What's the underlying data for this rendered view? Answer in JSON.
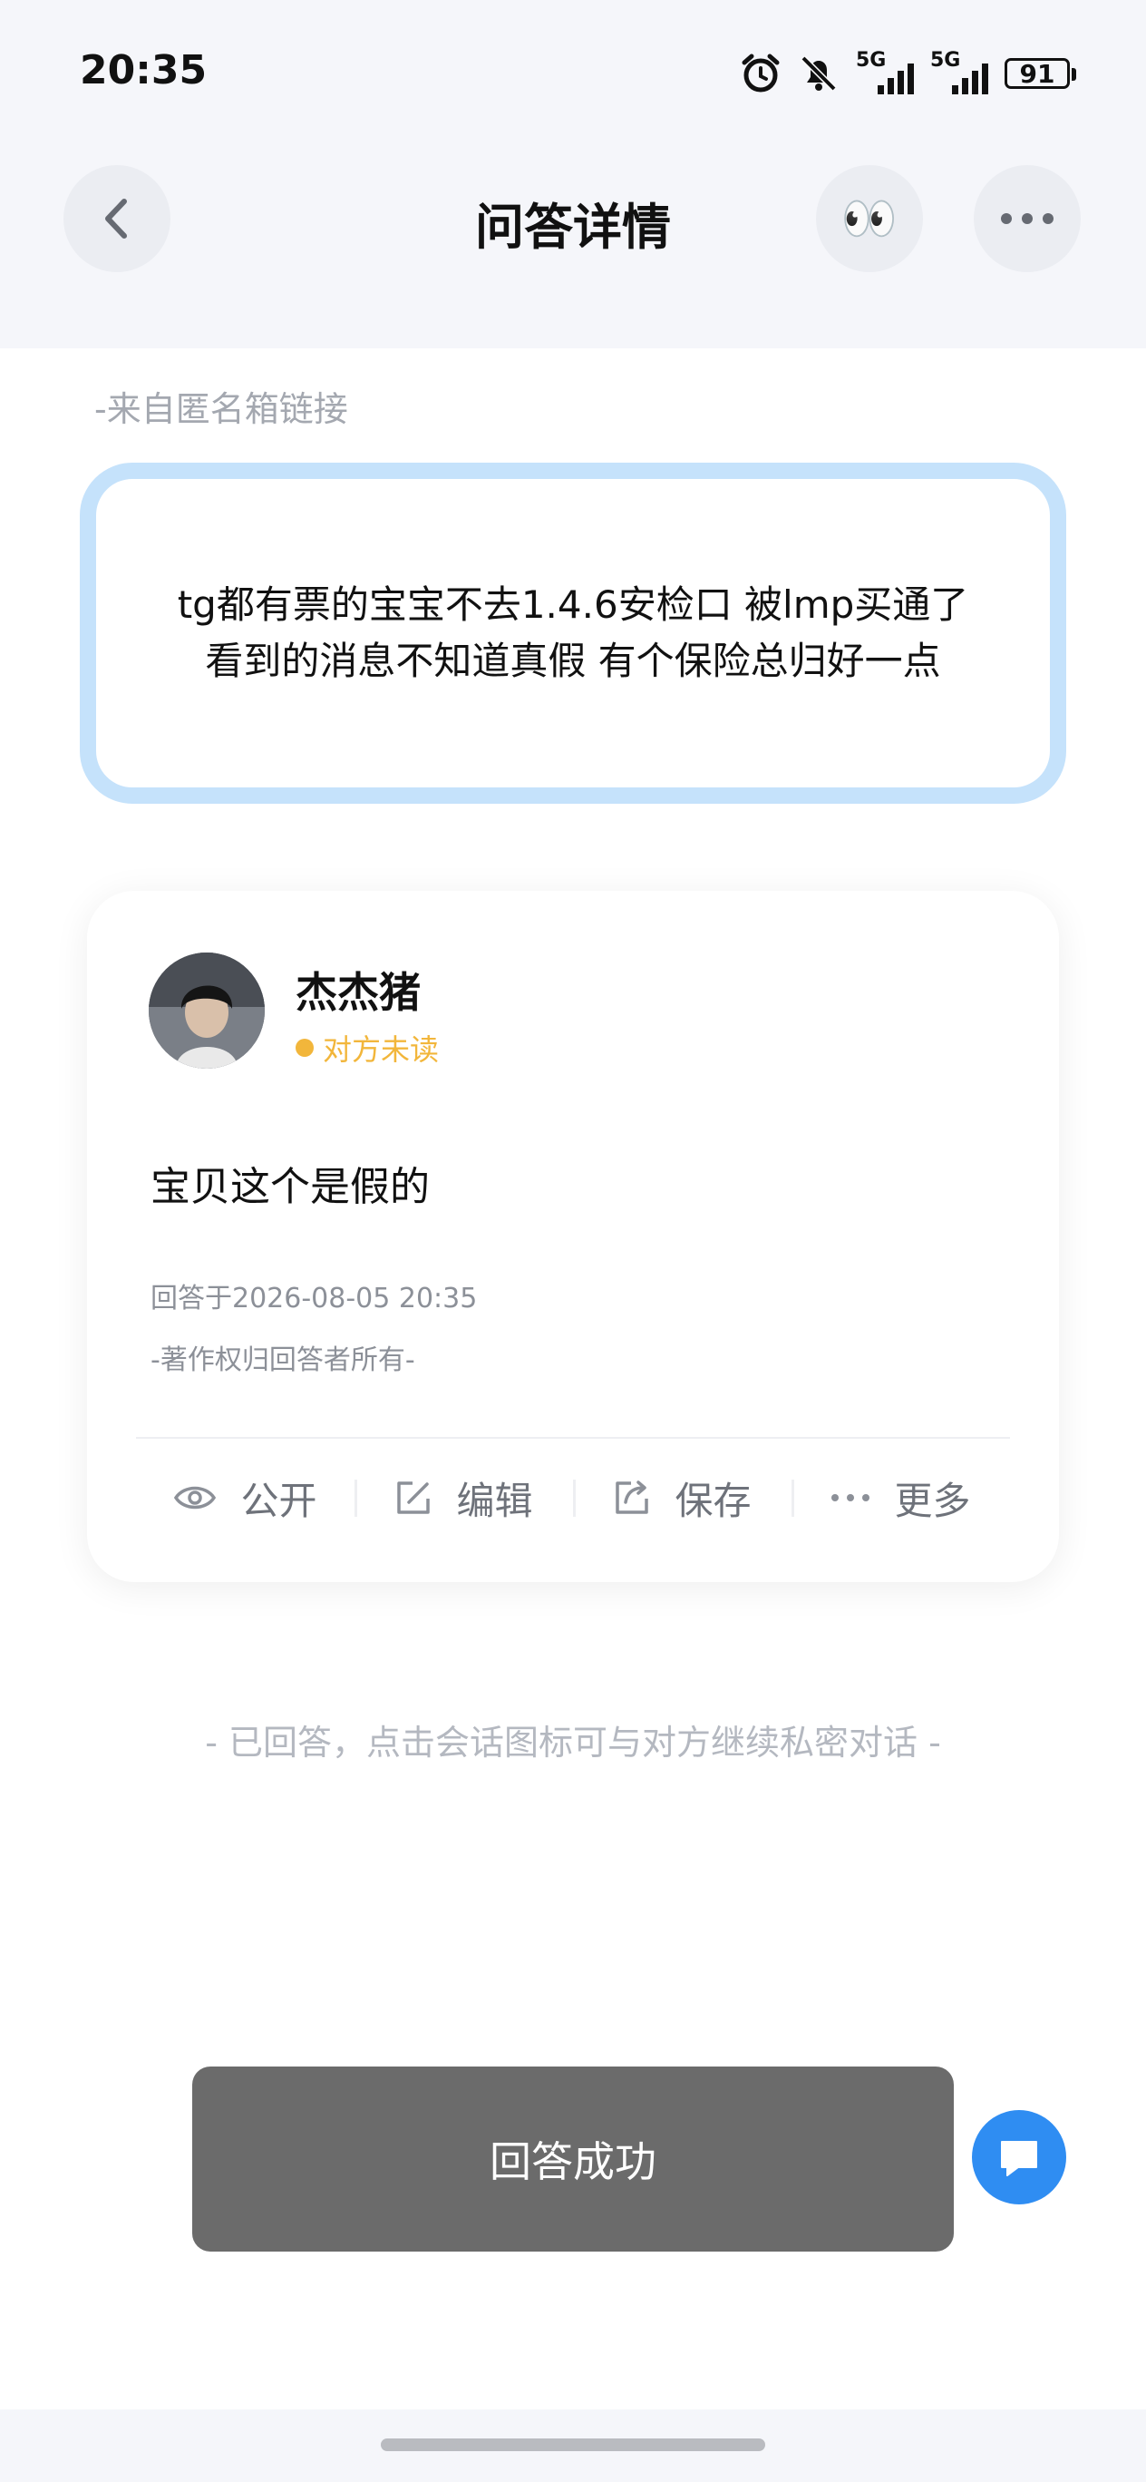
{
  "status_bar": {
    "time": "20:35",
    "network_1": "5G",
    "network_2": "5G",
    "battery": "91"
  },
  "header": {
    "title": "问答详情",
    "eyes_emoji": "👀"
  },
  "question": {
    "source": "-来自匿名箱链接",
    "text": "tg都有票的宝宝不去1.4.6安检口 被lmp买通了 看到的消息不知道真假 有个保险总归好一点"
  },
  "answer": {
    "username": "杰杰猪",
    "read_status": "对方未读",
    "text": "宝贝这个是假的",
    "answered_at": "回答于2026-08-05 20:35",
    "copyright": "-著作权归回答者所有-",
    "actions": {
      "public": "公开",
      "edit": "编辑",
      "save": "保存",
      "more": "更多"
    }
  },
  "hint": "- 已回答，点击会话图标可与对方继续私密对话 -",
  "toast": "回答成功",
  "colors": {
    "accent_blue": "#2f8df2",
    "question_border": "#c5e2fb",
    "unread_yellow": "#f2b63b"
  }
}
